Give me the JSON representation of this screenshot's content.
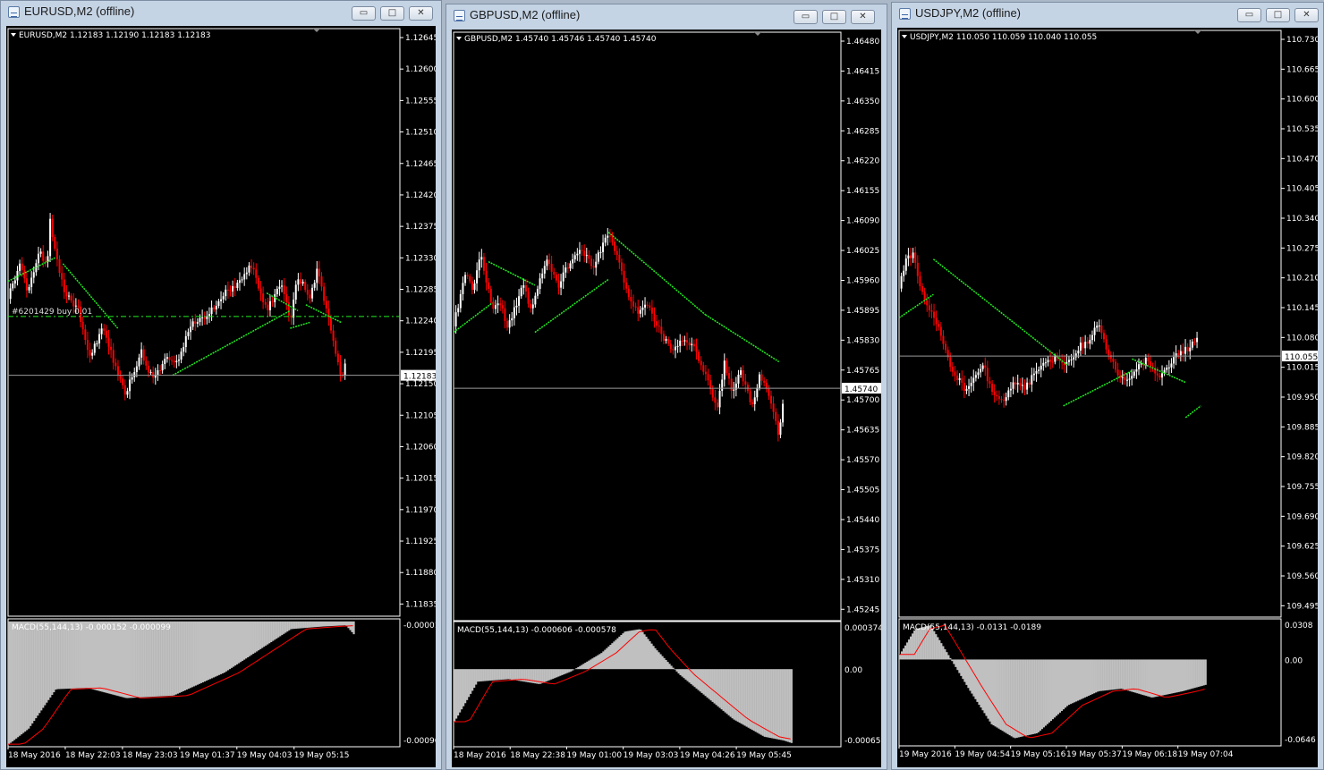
{
  "windows": [
    {
      "title": "EURUSD,M2 (offline)",
      "header": "EURUSD,M2  1.12183 1.12190 1.12183 1.12183",
      "current_price": "1.12183",
      "price_ticks": [
        "1.12645",
        "1.12600",
        "1.12555",
        "1.12510",
        "1.12465",
        "1.12420",
        "1.12375",
        "1.12330",
        "1.12285",
        "1.12240",
        "1.12195",
        "1.12150",
        "1.12105",
        "1.12060",
        "1.12015",
        "1.11970",
        "1.11925",
        "1.11880",
        "1.11835"
      ],
      "object_label": "#6201429 buy 0.01",
      "macd_label": "MACD(55,144,13) -0.000152 -0.000099",
      "macd_ticks": [
        "-0.00001",
        "-0.00096"
      ],
      "time_labels": [
        "18 May 2016",
        "18 May 22:03",
        "18 May 23:03",
        "19 May 01:37",
        "19 May 04:03",
        "19 May 05:15"
      ]
    },
    {
      "title": "GBPUSD,M2 (offline)",
      "header": "GBPUSD,M2  1.45740 1.45746 1.45740 1.45740",
      "current_price": "1.45740",
      "price_ticks": [
        "1.46480",
        "1.46415",
        "1.46350",
        "1.46285",
        "1.46220",
        "1.46155",
        "1.46090",
        "1.46025",
        "1.45960",
        "1.45895",
        "1.45830",
        "1.45765",
        "1.45700",
        "1.45635",
        "1.45570",
        "1.45505",
        "1.45440",
        "1.45375",
        "1.45310",
        "1.45245"
      ],
      "macd_label": "MACD(55,144,13) -0.000606 -0.000578",
      "macd_ticks": [
        "0.000374",
        "0.00",
        "-0.00065"
      ],
      "time_labels": [
        "18 May 2016",
        "18 May 22:38",
        "19 May 01:00",
        "19 May 03:03",
        "19 May 04:26",
        "19 May 05:45"
      ]
    },
    {
      "title": "USDJPY,M2 (offline)",
      "header": "USDJPY,M2  110.050 110.059 110.040 110.055",
      "current_price": "110.055",
      "price_ticks": [
        "110.730",
        "110.665",
        "110.600",
        "110.535",
        "110.470",
        "110.405",
        "110.340",
        "110.275",
        "110.210",
        "110.145",
        "110.080",
        "110.015",
        "109.950",
        "109.885",
        "109.820",
        "109.755",
        "109.690",
        "109.625",
        "109.560",
        "109.495"
      ],
      "macd_label": "MACD(55,144,13) -0.0131 -0.0189",
      "macd_ticks": [
        "0.0308",
        "0.00",
        "-0.0646"
      ],
      "time_labels": [
        "19 May 2016",
        "19 May 04:54",
        "19 May 05:16",
        "19 May 05:37",
        "19 May 06:18",
        "19 May 07:04"
      ]
    }
  ],
  "buttons": {
    "minimize": "▭",
    "maximize": "□",
    "close": "✕"
  },
  "colors": {
    "bull_candle": "#ffffff",
    "bear_candle": "#ff0000",
    "moving_average": "#22ee22",
    "macd_histogram": "#c0c0c0",
    "macd_signal": "#ff0000",
    "background": "#000000"
  }
}
